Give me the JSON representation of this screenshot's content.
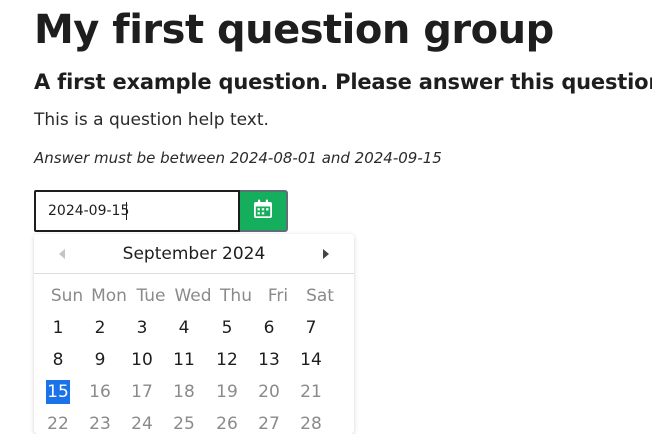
{
  "group": {
    "title": "My first question group"
  },
  "question": {
    "text": "A first example question. Please answer this question:",
    "help": "This is a question help text.",
    "tip": "Answer must be between 2024-08-01 and 2024-09-15"
  },
  "date_field": {
    "value": "2024-09-15",
    "button_icon": "calendar-icon",
    "button_color": "#14ae5c"
  },
  "datepicker": {
    "month_label": "September 2024",
    "prev_icon": "chevron-left-icon",
    "next_icon": "chevron-right-icon",
    "weekdays": [
      "Sun",
      "Mon",
      "Tue",
      "Wed",
      "Thu",
      "Fri",
      "Sat"
    ],
    "selected_day": "15",
    "selected_color": "#1a73e8",
    "weeks": [
      [
        "1",
        "2",
        "3",
        "4",
        "5",
        "6",
        "7"
      ],
      [
        "8",
        "9",
        "10",
        "11",
        "12",
        "13",
        "14"
      ],
      [
        "15",
        "16",
        "17",
        "18",
        "19",
        "20",
        "21"
      ],
      [
        "22",
        "23",
        "24",
        "25",
        "26",
        "27",
        "28"
      ]
    ]
  }
}
